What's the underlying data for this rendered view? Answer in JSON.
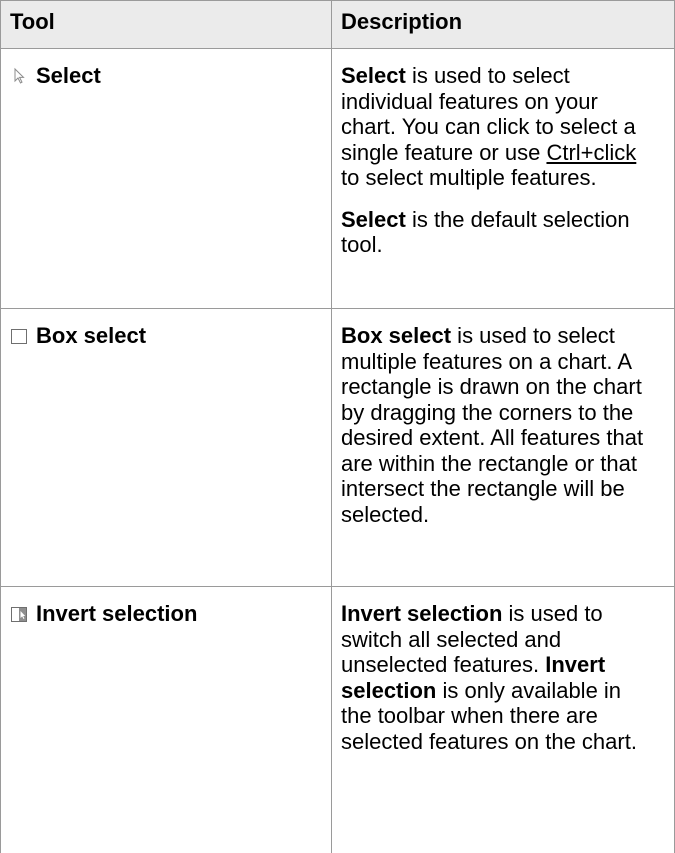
{
  "header": {
    "tool": "Tool",
    "description": "Description"
  },
  "rows": [
    {
      "tool": "Select",
      "icon": "select-arrow-icon",
      "p1_bold": "Select",
      "p1_a": " is used to select individual features on your chart. You can click to select a single feature or use ",
      "p1_link": "Ctrl+click",
      "p1_b": " to select multiple features.",
      "p2_bold": "Select",
      "p2_rest": " is the default selection tool."
    },
    {
      "tool": "Box select",
      "icon": "box-select-icon",
      "p1_bold": "Box select",
      "p1_rest": " is used to select multiple features on a chart. A rectangle is drawn on the chart by dragging the corners to the desired extent. All features that are within the rectangle or that intersect the rectangle will be selected."
    },
    {
      "tool": "Invert selection",
      "icon": "invert-selection-icon",
      "p1_bold": "Invert selection",
      "p1_rest": " is used to switch all selected and unselected features. ",
      "p1_bold2": "Invert selection",
      "p1_rest2": " is only available in the toolbar when there are selected features on the chart."
    }
  ]
}
